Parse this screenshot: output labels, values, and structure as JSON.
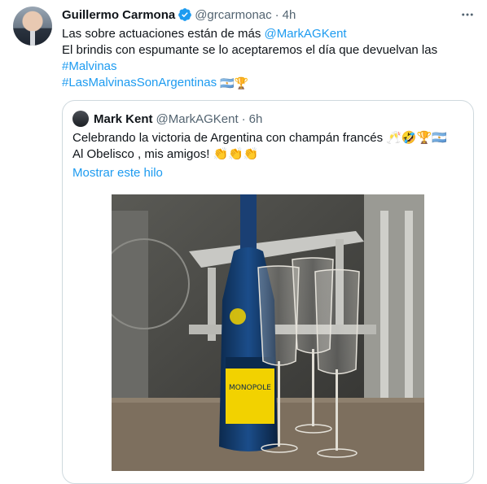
{
  "tweet": {
    "author_name": "Guillermo Carmona",
    "author_handle": "@grcarmonac",
    "separator": "·",
    "time": "4h",
    "more_label": "···",
    "body_line1_text": "Las sobre actuaciones están de más ",
    "body_line1_mention": "@MarkAGKent",
    "body_line2": "El brindis con espumante se lo aceptaremos el día que devuelvan las",
    "hashtag1": "#Malvinas",
    "hashtag2": "#LasMalvinasSonArgentinas",
    "hashtag2_emojis": "🇦🇷🏆"
  },
  "quote": {
    "author_name": "Mark Kent",
    "author_handle": "@MarkAGKent",
    "separator": "·",
    "time": "6h",
    "line1": "Celebrando la victoria de Argentina con champán francés 🥂🤣🏆🇦🇷",
    "line2": "Al Obelisco , mis amigos! 👏👏👏",
    "show_thread": "Mostrar este hilo",
    "photo_label_brand": "MONOPOLE"
  },
  "colors": {
    "link": "#1d9bf0",
    "secondary_text": "#536471",
    "border": "#cfd9de"
  }
}
